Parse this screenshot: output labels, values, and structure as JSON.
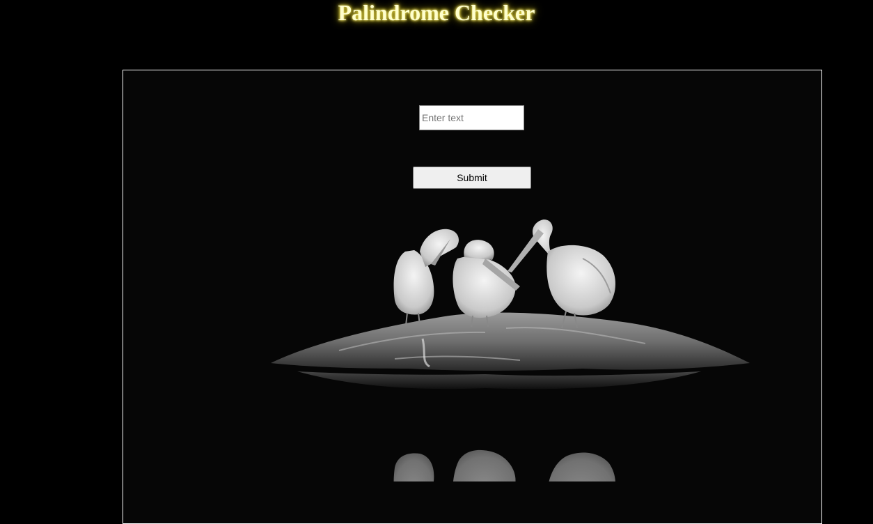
{
  "page": {
    "title": "Palindrome Checker"
  },
  "form": {
    "input_placeholder": "Enter text",
    "input_value": "",
    "submit_label": "Submit"
  },
  "image": {
    "subject": "pelicans-on-rock-with-reflection"
  },
  "colors": {
    "background": "#000000",
    "panel_background": "#060606",
    "panel_border": "#ffffff",
    "title_text": "#ffffcc",
    "title_glow": "#e8d84a"
  }
}
